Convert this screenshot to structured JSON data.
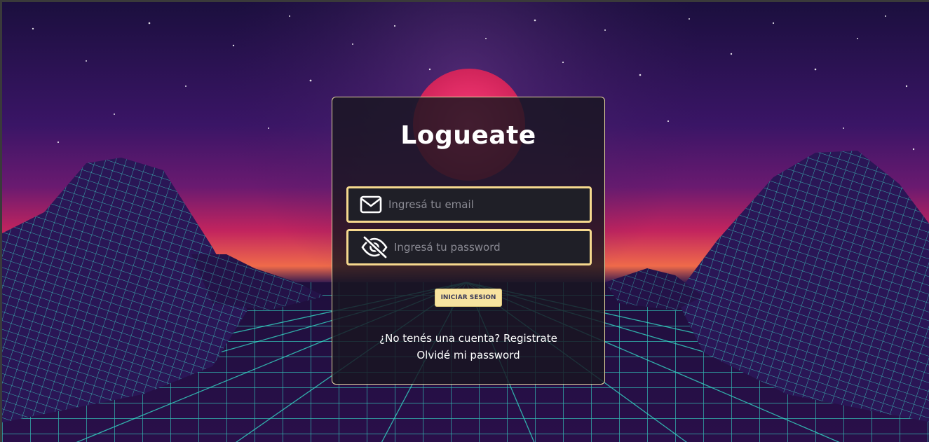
{
  "login": {
    "title": "Logueate",
    "email_placeholder": "Ingresá tu email",
    "email_value": "",
    "password_placeholder": "Ingresá tu password",
    "password_value": "",
    "submit_label": "INICIAR SESION",
    "signup_prompt": "¿No tenés una cuenta?",
    "signup_link": "Registrate",
    "forgot_link": "Olvidé mi password"
  },
  "icons": {
    "email": "envelope-icon",
    "password": "eye-slash-icon"
  },
  "colors": {
    "accent": "#f6d98e",
    "button_bg": "#f8e3a0",
    "card_bg": "#18161f",
    "grid": "#34d6c4"
  }
}
